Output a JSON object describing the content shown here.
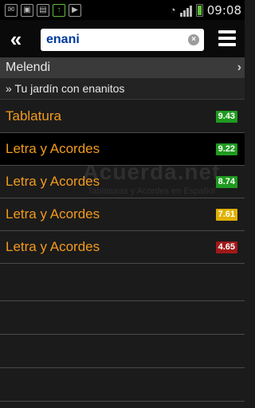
{
  "status_bar": {
    "time": "09:08",
    "icons": [
      "mail-icon",
      "image-icon",
      "sd-card-icon",
      "upload-icon",
      "play-icon",
      "wifi-icon",
      "signal-icon",
      "battery-icon"
    ]
  },
  "toolbar": {
    "back_label": "«",
    "search_value": "enani",
    "clear_label": "×"
  },
  "artist": {
    "name": "Melendi",
    "chevron": "›"
  },
  "album": {
    "name": "» Tu jardín con enanitos"
  },
  "results": [
    {
      "title": "Tablatura",
      "score": "9.43",
      "score_color": "#1f9a1f",
      "selected": false
    },
    {
      "title": "Letra y Acordes",
      "score": "9.22",
      "score_color": "#1f9a1f",
      "selected": true
    },
    {
      "title": "Letra y Acordes",
      "score": "8.74",
      "score_color": "#1f9a1f",
      "selected": false
    },
    {
      "title": "Letra y Acordes",
      "score": "7.61",
      "score_color": "#e0b000",
      "selected": false
    },
    {
      "title": "Letra y Acordes",
      "score": "4.65",
      "score_color": "#a01818",
      "selected": false
    }
  ],
  "watermark": {
    "title": "Acuerda.net",
    "subtitle": "Tablaturas y Acordes en Español"
  },
  "colors": {
    "accent_orange": "#f39a1c",
    "score_high": "#1f9a1f",
    "score_mid": "#e0b000",
    "score_low": "#a01818"
  }
}
